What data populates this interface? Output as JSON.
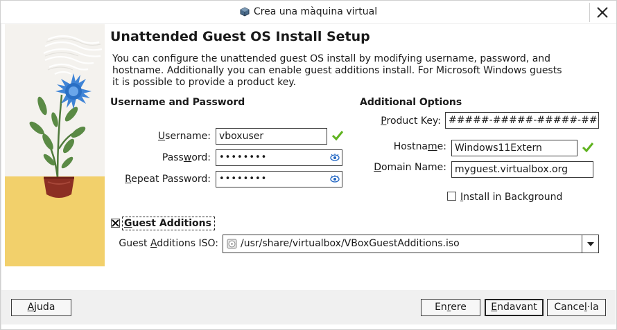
{
  "window": {
    "title": "Crea una màquina virtual",
    "title_icon": "virtualbox-icon",
    "close_icon": "close-icon"
  },
  "header": {
    "title": "Unattended Guest OS Install Setup",
    "description": "You can configure the unattended guest OS install by modifying username, password, and hostname. Additionally you can enable guest additions install. For Microsoft Windows guests it is possible to provide a product key."
  },
  "credentials": {
    "section_title": "Username and Password",
    "username_label_pre": "",
    "username_label_u": "U",
    "username_label_post": "sername:",
    "username_value": "vboxuser",
    "password_label_pre": "Pass",
    "password_label_u": "w",
    "password_label_post": "ord:",
    "password_value": "••••••••",
    "repeat_label_pre": "",
    "repeat_label_u": "R",
    "repeat_label_post": "epeat Password:",
    "repeat_value": "••••••••"
  },
  "additional": {
    "section_title": "Additional Options",
    "product_key_label_pre": "",
    "product_key_label_u": "P",
    "product_key_label_post": "roduct Key:",
    "product_key_value": "#####-#####-#####-#####-#####",
    "hostname_label_pre": "Hostna",
    "hostname_label_u": "m",
    "hostname_label_post": "e:",
    "hostname_value": "Windows11Extern",
    "domain_label_pre": "",
    "domain_label_u": "D",
    "domain_label_post": "omain Name:",
    "domain_value": "myguest.virtualbox.org",
    "install_bg_label_pre": "",
    "install_bg_label_u": "I",
    "install_bg_label_post": "nstall in Background",
    "install_bg_checked": false
  },
  "guest_additions": {
    "checkbox_label_pre": "",
    "checkbox_label_u": "G",
    "checkbox_label_post": "uest Additions",
    "checked": true,
    "iso_label_pre": "Guest ",
    "iso_label_u": "A",
    "iso_label_post": "dditions ISO:",
    "iso_value": "/usr/share/virtualbox/VBoxGuestAdditions.iso"
  },
  "buttons": {
    "help_pre": "",
    "help_u": "A",
    "help_post": "juda",
    "back_pre": "En",
    "back_u": "r",
    "back_post": "ere",
    "next_pre": "",
    "next_u": "E",
    "next_post": "ndavant",
    "cancel_pre": "Cance",
    "cancel_u": "l",
    "cancel_post": "·la"
  },
  "colors": {
    "valid_check": "#5fb31f",
    "eye_icon": "#1f64c2",
    "bottom_bar": "#f0f0f0"
  }
}
